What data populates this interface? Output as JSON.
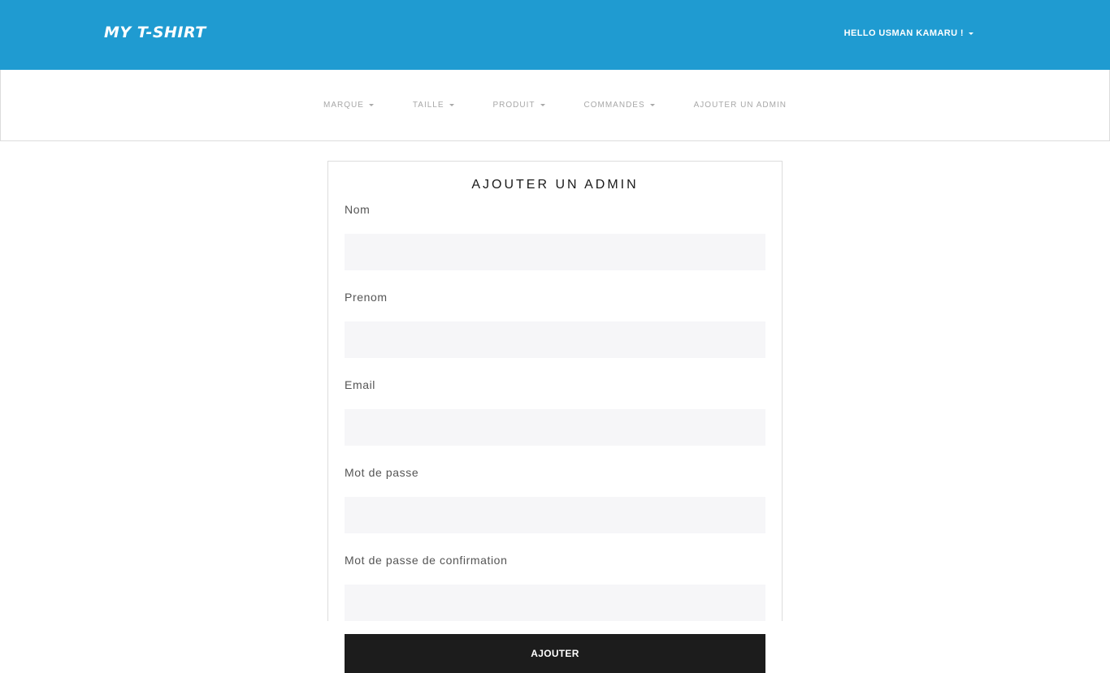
{
  "header": {
    "brand": "MY T-SHIRT",
    "user_greeting": "HELLO USMAN KAMARU !"
  },
  "nav": {
    "items": [
      {
        "label": "MARQUE",
        "dropdown": true
      },
      {
        "label": "TAILLE",
        "dropdown": true
      },
      {
        "label": "PRODUIT",
        "dropdown": true
      },
      {
        "label": "COMMANDES",
        "dropdown": true
      },
      {
        "label": "AJOUTER UN ADMIN",
        "dropdown": false
      }
    ]
  },
  "form": {
    "title": "AJOUTER UN ADMIN",
    "fields": [
      {
        "label": "Nom",
        "value": "",
        "placeholder": ""
      },
      {
        "label": "Prenom",
        "value": "",
        "placeholder": ""
      },
      {
        "label": "Email",
        "value": "",
        "placeholder": ""
      },
      {
        "label": "Mot de passe",
        "value": "",
        "placeholder": ""
      },
      {
        "label": "Mot de passe de confirmation",
        "value": "",
        "placeholder": ""
      }
    ],
    "submit_label": "AJOUTER"
  },
  "colors": {
    "header_bg": "#1f9bd1",
    "button_bg": "#1c1c1c",
    "input_bg": "#f6f6f8"
  }
}
